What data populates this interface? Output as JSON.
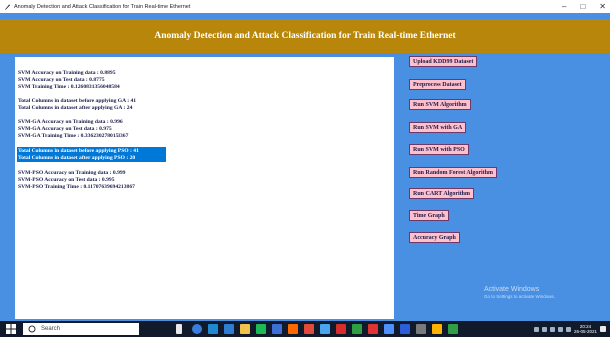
{
  "window": {
    "title": "Anomaly Detection and Attack Classification for Train Real-time Ethernet",
    "controls": {
      "minimize": "–",
      "maximize": "□",
      "close": "✕"
    }
  },
  "app": {
    "header_title": "Anomaly Detection and Attack Classification for Train Real-time Ethernet",
    "bg_color": "#4a90e2",
    "header_color": "#b8860b",
    "button_color": "#ffc0cb"
  },
  "console": {
    "lines": [
      "SVM Accuracy on Training data : 0.8895",
      "SVM Accuracy on Test data : 0.8775",
      "SVM Training Time : 0.1260831356048584",
      "Total Columns in dataset before applying GA : 41",
      "Total Columns in dataset after applying GA : 24",
      "SVM-GA Accuracy on Training data : 0.996",
      "SVM-GA Accuracy on Test data : 0.975",
      "SVM-GA Training Time : 0.336230278015l367",
      "Total Columns in dataset before applying PSO : 41",
      "Total Columns in dataset after applying PSO : 20",
      "SVM-PSO Accuracy on Training data : 0.999",
      "SVM-PSO Accuracy on Test data : 0.995",
      "SVM-PSO Training Time : 0.11707639694213867"
    ]
  },
  "buttons": {
    "upload": "Upload KDD99 Dataset",
    "preprocess": "Preprocess Dataset",
    "svm": "Run SVM Algorithm",
    "svm_ga": "Run SVM with GA",
    "svm_pso": "Run SVM with PSO",
    "random_forest": "Run Random Forest Algorithm",
    "cart": "Run CART Algorithm",
    "time_graph": "Time Graph",
    "accuracy_graph": "Accuracy Graph"
  },
  "watermark": {
    "line1": "Activate Windows",
    "line2": "Go to Settings to activate Windows."
  },
  "taskbar": {
    "search_label": "Search",
    "time": "20:24",
    "date": "26-05-2021"
  }
}
